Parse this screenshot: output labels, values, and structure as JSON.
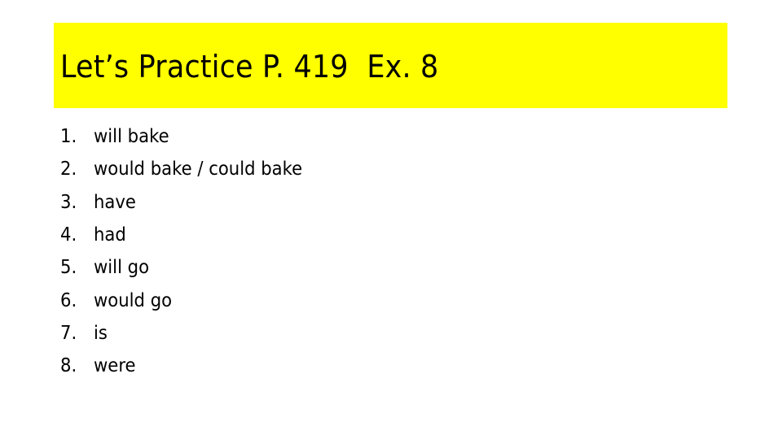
{
  "slide": {
    "title": "Let’s Practice P. 419  Ex. 8",
    "title_bg_color": "#ffff00",
    "answers": [
      {
        "number": "1.",
        "text": "will bake"
      },
      {
        "number": "2.",
        "text": "would bake / could bake"
      },
      {
        "number": "3.",
        "text": "have"
      },
      {
        "number": "4.",
        "text": "had"
      },
      {
        "number": "5.",
        "text": "will go"
      },
      {
        "number": "6.",
        "text": "would go"
      },
      {
        "number": "7.",
        "text": "is"
      },
      {
        "number": "8.",
        "text": "were"
      }
    ]
  }
}
